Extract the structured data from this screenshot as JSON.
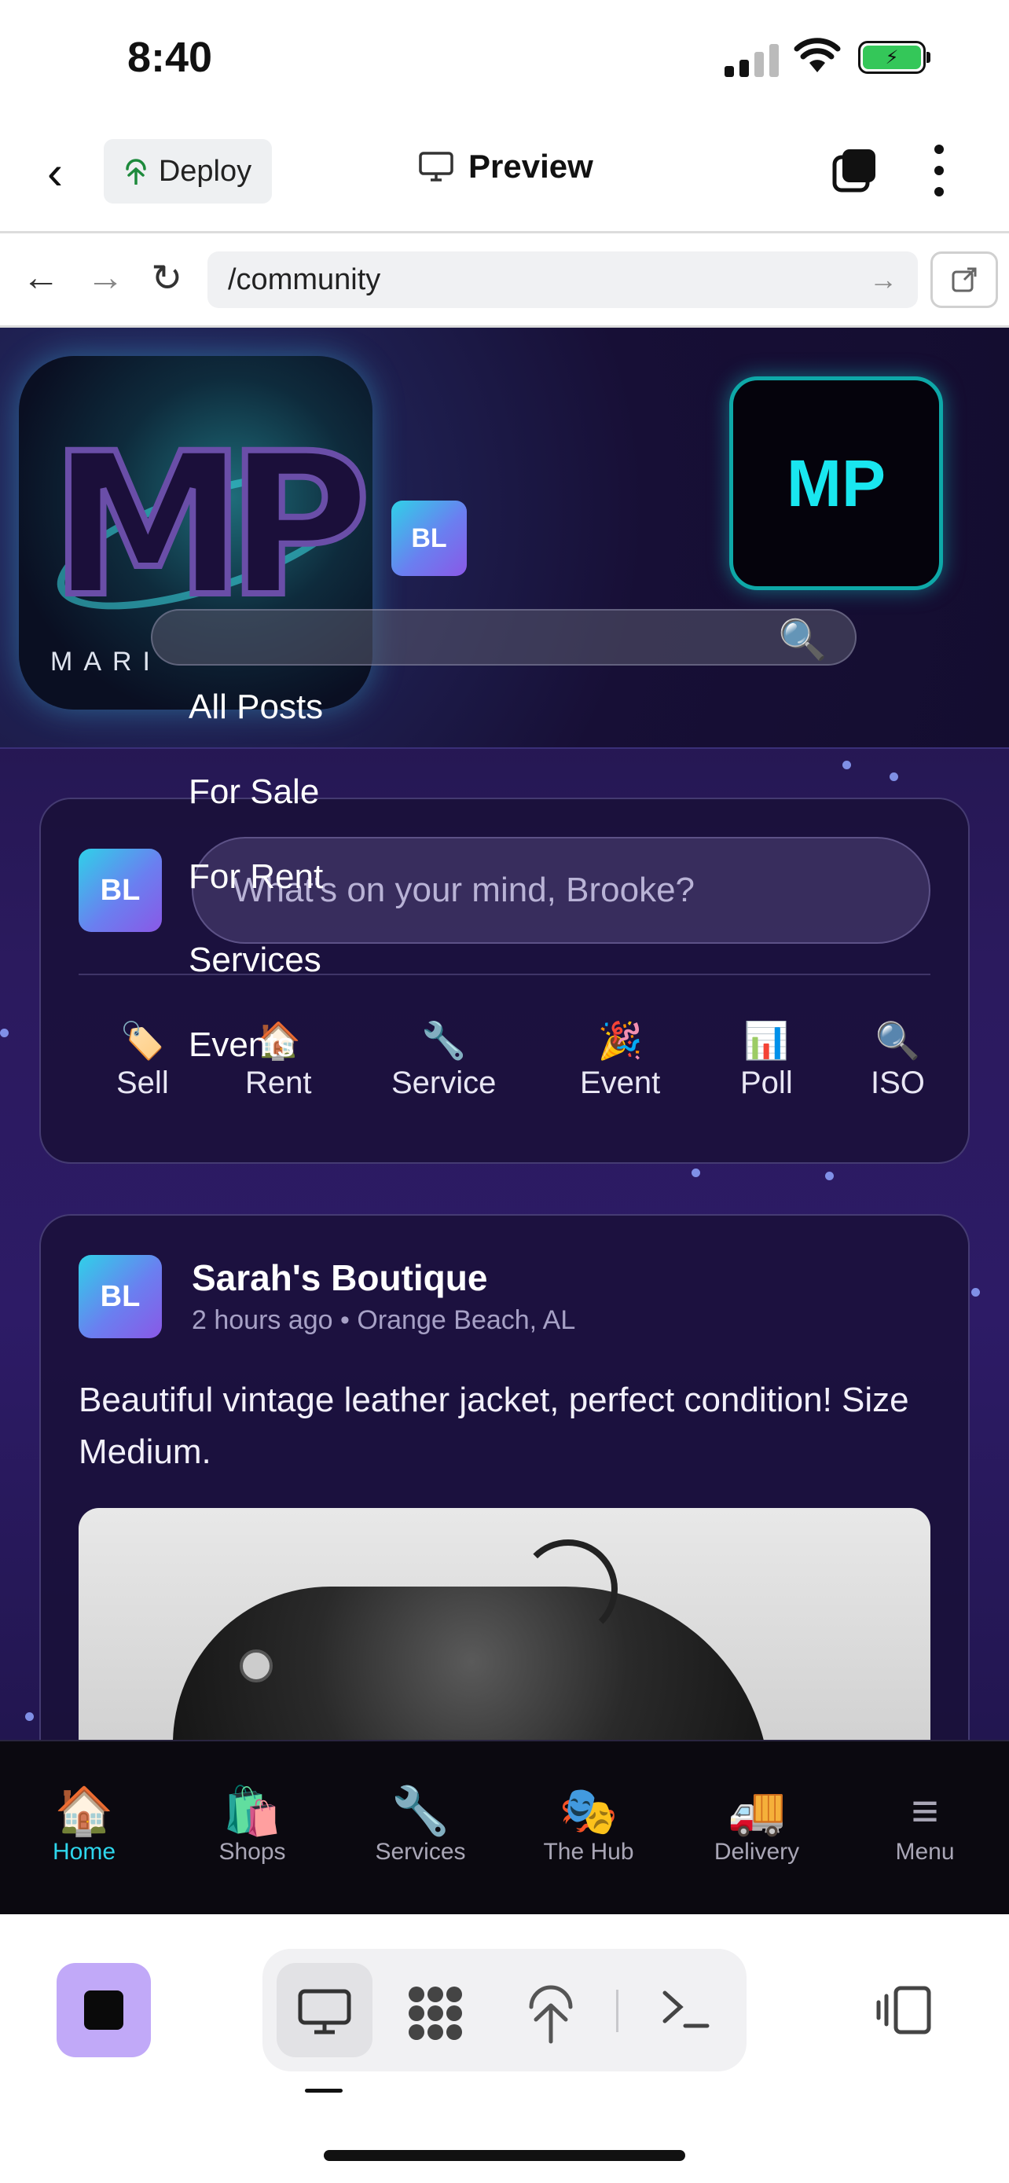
{
  "status_bar": {
    "time": "8:40"
  },
  "app_bar": {
    "deploy_label": "Deploy",
    "preview_label": "Preview"
  },
  "browser": {
    "url": "/community"
  },
  "header": {
    "logo_text": "MARI",
    "user_initials": "BL",
    "badge_text": "MP"
  },
  "filters": [
    "All Posts",
    "For Sale",
    "For Rent",
    "Services",
    "Events"
  ],
  "composer": {
    "avatar_initials": "BL",
    "placeholder": "What's on your mind, Brooke?",
    "actions": [
      {
        "icon": "tag-icon",
        "glyph": "🏷️",
        "label": "Sell"
      },
      {
        "icon": "house-icon",
        "glyph": "🏠",
        "label": "Rent"
      },
      {
        "icon": "wrench-icon",
        "glyph": "🔧",
        "label": "Service"
      },
      {
        "icon": "party-icon",
        "glyph": "🎉",
        "label": "Event"
      },
      {
        "icon": "chart-icon",
        "glyph": "📊",
        "label": "Poll"
      },
      {
        "icon": "magnifier-icon",
        "glyph": "🔍",
        "label": "ISO"
      }
    ]
  },
  "post": {
    "avatar_initials": "BL",
    "author": "Sarah's Boutique",
    "meta": "2 hours ago • Orange Beach, AL",
    "body": "Beautiful vintage leather jacket, perfect condition! Size Medium."
  },
  "tabbar": [
    {
      "icon": "house-icon",
      "glyph": "🏠",
      "label": "Home",
      "active": true
    },
    {
      "icon": "shopping-bags-icon",
      "glyph": "🛍️",
      "label": "Shops"
    },
    {
      "icon": "wrench-icon",
      "glyph": "🔧",
      "label": "Services"
    },
    {
      "icon": "theater-masks-icon",
      "glyph": "🎭",
      "label": "The Hub"
    },
    {
      "icon": "delivery-truck-icon",
      "glyph": "🚚",
      "label": "Delivery"
    },
    {
      "icon": "hamburger-menu-icon",
      "glyph": "≡",
      "label": "Menu"
    }
  ],
  "colors": {
    "accent": "#2ed6ec",
    "badge_border": "#0ea8a8",
    "stop_button": "#c1a9f8"
  }
}
